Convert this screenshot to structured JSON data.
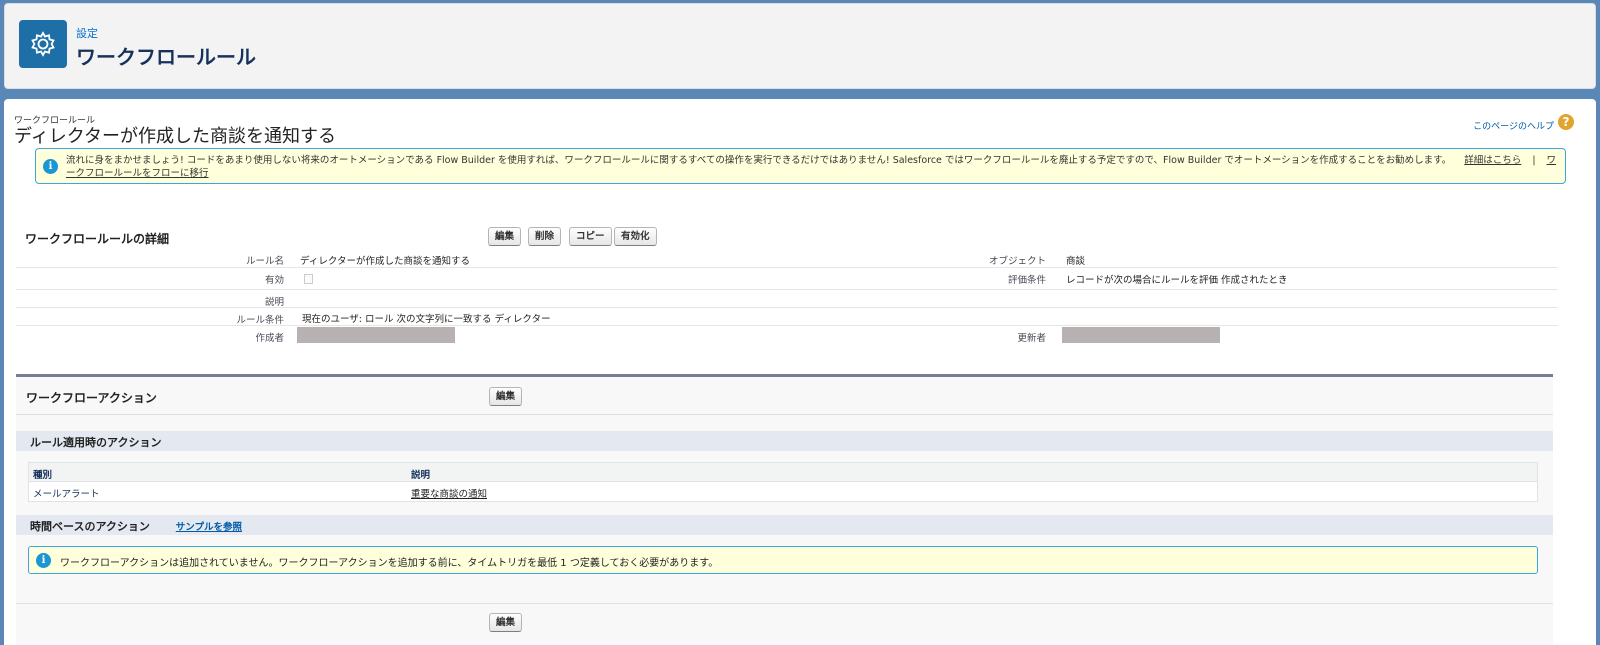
{
  "header": {
    "breadcrumb": "設定",
    "title": "ワークフロールール"
  },
  "page": {
    "type_label": "ワークフロールール",
    "title": "ディレクターが作成した商談を通知する",
    "help_link": "このページのヘルプ",
    "help_icon": "?"
  },
  "notice": {
    "text": "流れに身をまかせましょう! コードをあまり使用しない将来のオートメーションである Flow Builder を使用すれば、ワークフロールールに関するすべての操作を実行できるだけではありません! Salesforce ではワークフロールールを廃止する予定ですので、Flow Builder でオートメーションを作成することをお勧めします。",
    "link_details": "詳細はこちら",
    "separator": "|",
    "link_migrate": "ワークフロールールをフローに移行"
  },
  "detail": {
    "heading": "ワークフロールールの詳細",
    "buttons": {
      "edit": "編集",
      "delete": "削除",
      "copy": "コピー",
      "activate": "有効化"
    },
    "fields": {
      "rule_name_label": "ルール名",
      "rule_name_value": "ディレクターが作成した商談を通知する",
      "object_label": "オブジェクト",
      "object_value": "商談",
      "active_label": "有効",
      "active_value": false,
      "eval_label": "評価条件",
      "eval_value": "レコードが次の場合にルールを評価 作成されたとき",
      "description_label": "説明",
      "criteria_label": "ルール条件",
      "criteria_value": "現在のユーザ: ロール 次の文字列に一致する ディレクター",
      "created_by_label": "作成者",
      "modified_by_label": "更新者"
    }
  },
  "workflow_actions": {
    "heading": "ワークフローアクション",
    "edit_button": "編集",
    "immediate": {
      "heading": "ルール適用時のアクション",
      "columns": [
        "種別",
        "説明"
      ],
      "rows": [
        {
          "type": "メールアラート",
          "description": "重要な商談の通知"
        }
      ]
    },
    "time_based": {
      "heading": "時間ベースのアクション",
      "sample_link": "サンプルを参照",
      "info": "ワークフローアクションは追加されていません。ワークフローアクションを追加する前に、タイムトリガを最低 1 つ定義しておく必要があります。"
    },
    "bottom_edit_button": "編集"
  },
  "colors": {
    "brand_blue": "#1e6ea7",
    "background": "#5b87b8",
    "notice_bg": "#ffffdc",
    "notice_border": "#39a8e0",
    "redaction": "#b8b1b1"
  }
}
